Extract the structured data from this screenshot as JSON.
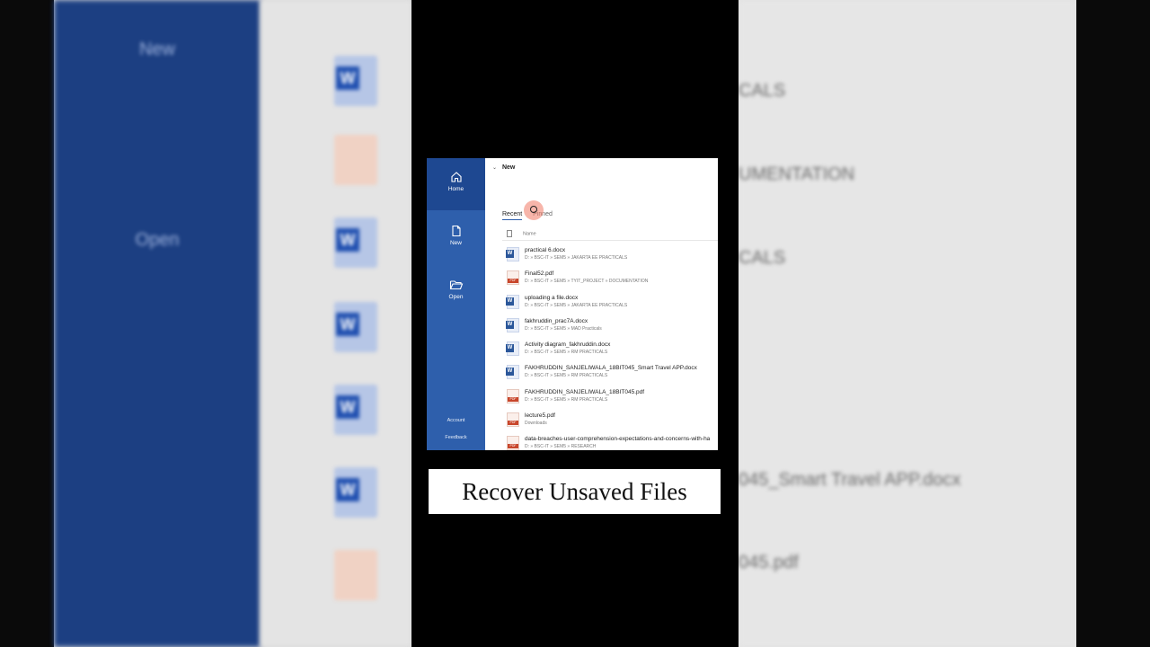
{
  "background": {
    "left_nav": [
      "New",
      "Open"
    ],
    "right_fragments": [
      "CALS",
      "UMENTATION",
      "CALS",
      "045_Smart Travel  APP.docx",
      "045.pdf"
    ]
  },
  "nav": {
    "home": "Home",
    "new": "New",
    "open": "Open",
    "account": "Account",
    "feedback": "Feedback"
  },
  "main": {
    "new_header": "New",
    "tabs": {
      "recent": "Recent",
      "pinned": "Pinned"
    },
    "column_name": "Name",
    "files": [
      {
        "name": "practical 6.docx",
        "path": "D: » BSC-IT » SEM5 » JAKARTA EE PRACTICALS",
        "type": "word"
      },
      {
        "name": "Final52.pdf",
        "path": "D: » BSC-IT » SEM5 » TYIT_PROJECT » DOCUMENTATION",
        "type": "pdf"
      },
      {
        "name": "uploading a file.docx",
        "path": "D: » BSC-IT » SEM5 » JAKARTA EE PRACTICALS",
        "type": "word"
      },
      {
        "name": "fakhruddin_prac7A.docx",
        "path": "D: » BSC-IT » SEM5 » MAD Practicals",
        "type": "word"
      },
      {
        "name": "Activity diagram_fakhruddin.docx",
        "path": "D: » BSC-IT » SEM5 » RM PRACTICALS",
        "type": "word"
      },
      {
        "name": "FAKHRUDDIN_SANJELIWALA_18BIT045_Smart Travel  APP.docx",
        "path": "D: » BSC-IT » SEM5 » RM PRACTICALS",
        "type": "word"
      },
      {
        "name": "FAKHRUDDIN_SANJELIWALA_18BIT045.pdf",
        "path": "D: » BSC-IT » SEM5 » RM PRACTICALS",
        "type": "pdf"
      },
      {
        "name": "lecture5.pdf",
        "path": "Downloads",
        "type": "pdf"
      },
      {
        "name": "data-breaches-user-comprehension-expectations-and-concerns-with-ha",
        "path": "D: » BSC-IT » SEM5 » RESEARCH",
        "type": "pdf"
      }
    ]
  },
  "caption": "Recover Unsaved Files"
}
